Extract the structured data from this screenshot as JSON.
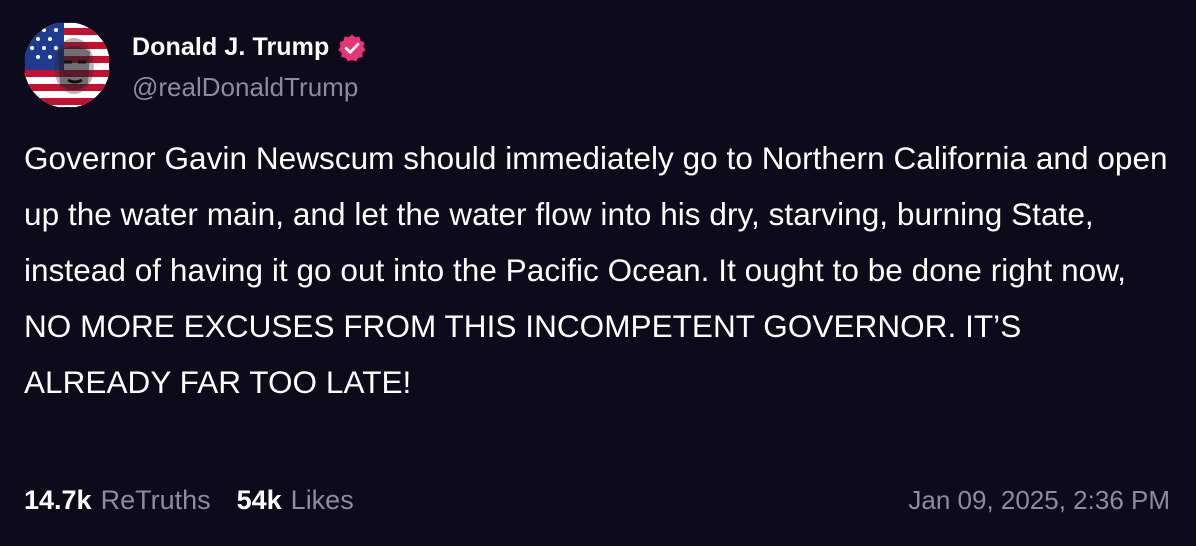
{
  "author": {
    "display_name": "Donald J. Trump",
    "handle": "@realDonaldTrump",
    "verified_icon": "verified-badge-icon",
    "verified_color": "#e53673"
  },
  "post": {
    "text": "Governor Gavin Newscum should immediately go to Northern California and open up the water main, and let the water flow into his dry, starving, burning State, instead of having it go out into the Pacific Ocean. It ought to be done right now, NO MORE EXCUSES FROM THIS INCOMPETENT GOVERNOR. IT’S ALREADY FAR TOO LATE!"
  },
  "stats": {
    "retruths_count": "14.7k",
    "retruths_label": "ReTruths",
    "likes_count": "54k",
    "likes_label": "Likes"
  },
  "timestamp": "Jan 09, 2025, 2:36 PM",
  "colors": {
    "background": "#0c0a1b",
    "text": "#ffffff",
    "muted": "#8d8aa2"
  }
}
